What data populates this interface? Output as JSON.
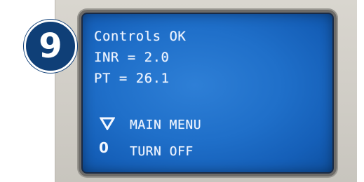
{
  "step": {
    "number": "9"
  },
  "screen": {
    "lines": [
      "Controls OK",
      "INR = 2.0",
      "PT = 26.1"
    ],
    "menu": [
      {
        "icon": "triangle-down-icon",
        "label": "MAIN MENU"
      },
      {
        "icon": "zero-icon",
        "icon_text": "0",
        "label": "TURN OFF"
      }
    ]
  },
  "colors": {
    "screen_blue": "#1f6fc9",
    "text": "#eef4ff",
    "bezel": "#d9d6cf",
    "badge": "#0f3f77"
  }
}
